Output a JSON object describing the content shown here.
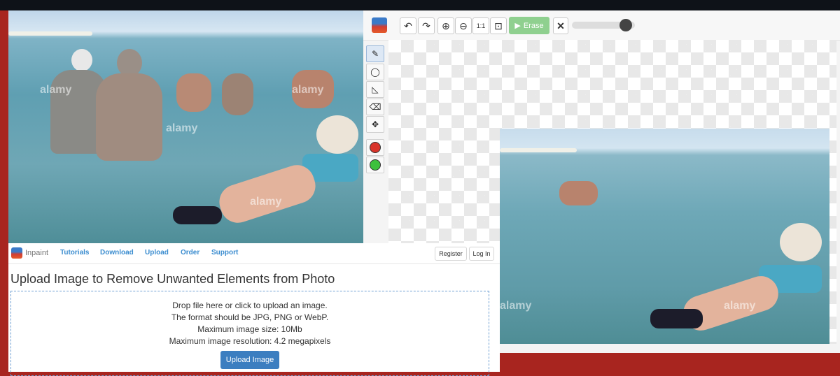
{
  "editor": {
    "toolbar": {
      "undo_icon": "undo-icon",
      "redo_icon": "redo-icon",
      "zoom_in_icon": "zoom-in-icon",
      "zoom_out_icon": "zoom-out-icon",
      "zoom_actual_icon": "zoom-actual-size-icon",
      "zoom_fit_icon": "zoom-fit-icon",
      "erase_label": "Erase",
      "clear_icon": "close-icon",
      "brush_size": 0.85
    },
    "tools": [
      "marker-icon",
      "lasso-icon",
      "polygon-lasso-icon",
      "eraser-icon",
      "move-icon",
      "red-color",
      "green-color"
    ],
    "colors": {
      "red": "#d9342b",
      "green": "#3cc13c",
      "erase_button": "#8fd08f"
    }
  },
  "site": {
    "brand": "Inpaint",
    "nav": [
      "Tutorials",
      "Download",
      "Upload",
      "Order",
      "Support"
    ],
    "register_label": "Register",
    "login_label": "Log In",
    "headline": "Upload Image to Remove Unwanted Elements from Photo",
    "dropzone": {
      "line1": "Drop file here or click to upload an image.",
      "line2": "The format should be JPG, PNG or WebP.",
      "line3": "Maximum image size: 10Mb",
      "line4": "Maximum image resolution: 4.2 megapixels",
      "button": "Upload Image"
    },
    "accent": "#3a8ccf"
  },
  "watermark": "alamy"
}
